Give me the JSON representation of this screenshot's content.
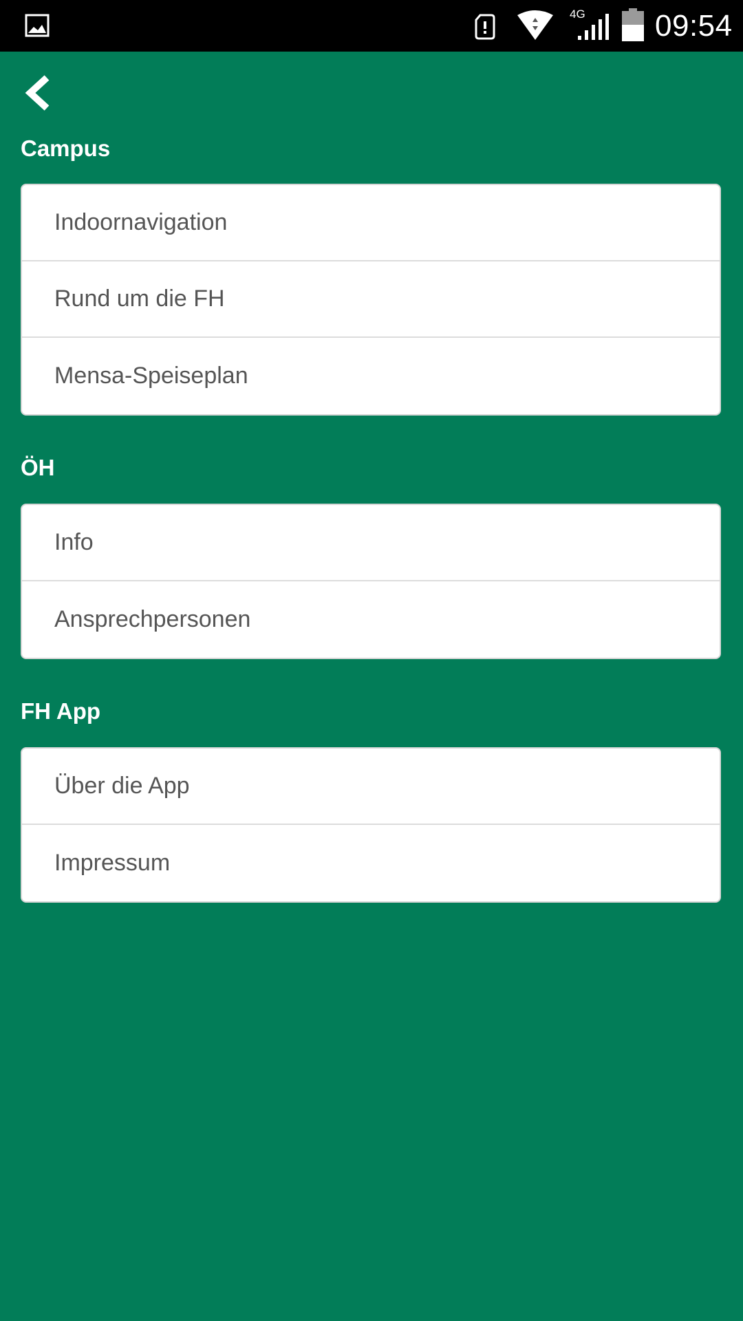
{
  "status_bar": {
    "time": "09:54",
    "network_type": "4G",
    "icons": [
      "image-notification-icon",
      "sim-card-icon",
      "wifi-icon",
      "cellular-signal-icon",
      "battery-icon"
    ]
  },
  "nav": {
    "back_icon": "chevron-left-icon"
  },
  "colors": {
    "background": "#027d58",
    "card": "#ffffff",
    "item_text": "#555555",
    "section_title": "#ffffff"
  },
  "sections": [
    {
      "title": "Campus",
      "items": [
        "Indoornavigation",
        "Rund um die FH",
        "Mensa-Speiseplan"
      ]
    },
    {
      "title": "ÖH",
      "items": [
        "Info",
        "Ansprechpersonen"
      ]
    },
    {
      "title": "FH App",
      "items": [
        "Über die App",
        "Impressum"
      ]
    }
  ]
}
